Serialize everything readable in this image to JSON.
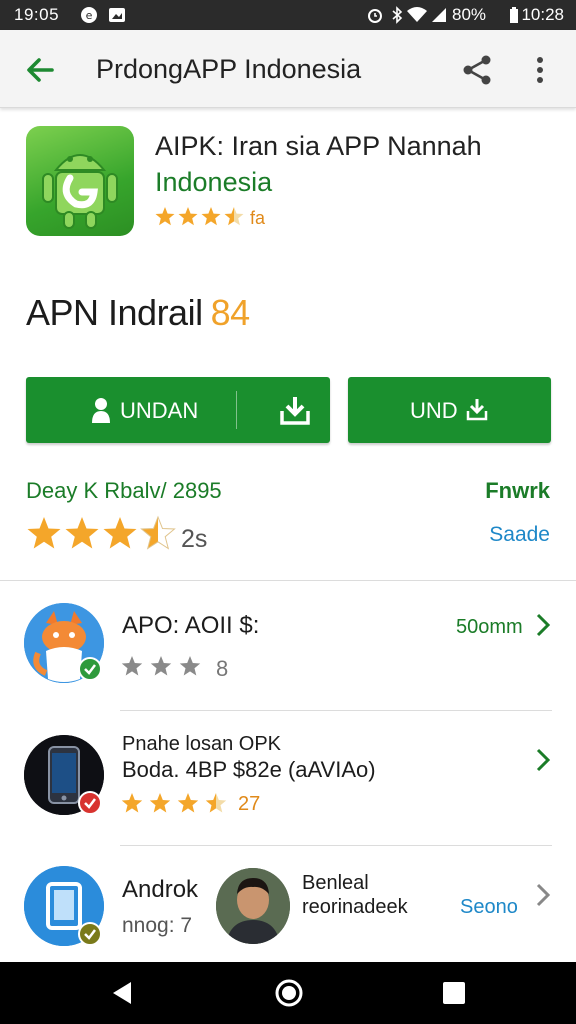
{
  "status_bar": {
    "time": "19:05",
    "battery": "80%",
    "right_time": "10:28"
  },
  "app_bar": {
    "title": "PrdongAPP Indonesia",
    "back_icon": "arrow-back-icon",
    "share_icon": "share-icon",
    "more_icon": "more-vert-icon"
  },
  "header": {
    "app_name_line1": "AIPK: Iran sia APP Nannah",
    "app_name_line2": "Indonesia",
    "stars": 3.5,
    "rating_text": "fa"
  },
  "section": {
    "title": "APN Indrail",
    "accent": "84"
  },
  "buttons": {
    "install_label": "UNDAN",
    "und_label": "UND"
  },
  "details": {
    "developer_line": "Deay K Rbalv/ 2895",
    "right_label": "Fnwrk",
    "stars": 3.5,
    "rating_count": "2s",
    "link_label": "Saade"
  },
  "list": [
    {
      "title": "APO: AOII $:",
      "rating": "8",
      "stars": 3,
      "right": "50omm",
      "icon": "android-fox-icon"
    },
    {
      "title_line1": "Pnahe losan OPK",
      "title_line2": "Boda. 4BP  $82e (aAVIAo)",
      "rating": "27",
      "stars": 3.5,
      "icon": "phone-app-icon"
    },
    {
      "title": "Androk",
      "sub": "nnog: 7",
      "person_line1": "Benleal",
      "person_line2": "reorinadeek",
      "right": "Seono",
      "icon": "tablet-app-icon"
    }
  ],
  "colors": {
    "green": "#1a8f2e",
    "dark_green_text": "#1b7c28",
    "star": "#f4a62a",
    "link_blue": "#1e88c8"
  }
}
